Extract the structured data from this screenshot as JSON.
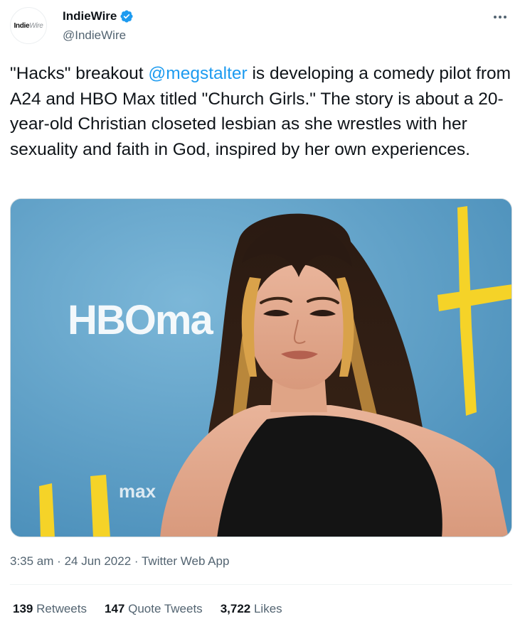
{
  "author": {
    "avatar_logo_bold": "Indie",
    "avatar_logo_light": "Wire",
    "display_name": "IndieWire",
    "handle": "@IndieWire"
  },
  "tweet": {
    "text_before": "\"Hacks\" breakout ",
    "mention": "@megstalter",
    "text_after": " is developing a comedy pilot from A24 and HBO Max titled \"Church Girls.\" The story is about a 20-year-old Christian closeted lesbian as she wrestles with her sexuality and faith in God, inspired by her own experiences."
  },
  "media": {
    "backdrop_logo_text": "HBOma",
    "backdrop_small_text": "max",
    "colors": {
      "backdrop": "#5b9fc6",
      "accent_yellow": "#f5d328",
      "dress": "#141414"
    }
  },
  "meta": {
    "time": "3:35 am",
    "date": "24 Jun 2022",
    "source": "Twitter Web App"
  },
  "stats": [
    {
      "num": "139",
      "label": "Retweets"
    },
    {
      "num": "147",
      "label": "Quote Tweets"
    },
    {
      "num": "3,722",
      "label": "Likes"
    }
  ],
  "icons": {
    "verified": "verified-badge-icon",
    "more": "more-options-icon"
  },
  "colors": {
    "link": "#1d9bf0",
    "secondary_text": "#536471",
    "primary_text": "#0f1419"
  }
}
